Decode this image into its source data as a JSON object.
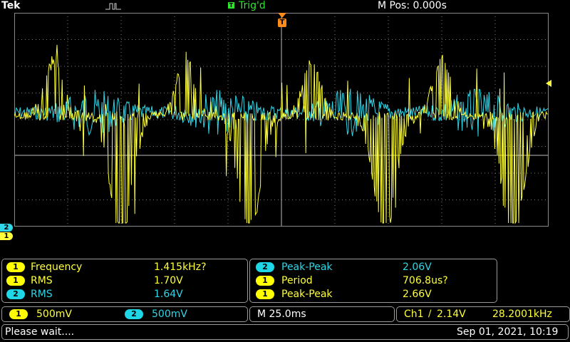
{
  "header": {
    "brand": "Tek",
    "trigger_icon": "T",
    "trigger_state": "Trig'd",
    "position": "M Pos: 0.000s"
  },
  "markers": {
    "trigger_marker": "T",
    "ch2_marker": "2",
    "ch1_marker": "1"
  },
  "measurements_left": [
    {
      "channel": "1",
      "label": "Frequency",
      "value": "1.415kHz?"
    },
    {
      "channel": "1",
      "label": "RMS",
      "value": "1.70V"
    },
    {
      "channel": "2",
      "label": "RMS",
      "value": "1.64V"
    }
  ],
  "measurements_right": [
    {
      "channel": "2",
      "label": "Peak-Peak",
      "value": "2.06V"
    },
    {
      "channel": "1",
      "label": "Period",
      "value": "706.8us?"
    },
    {
      "channel": "1",
      "label": "Peak-Peak",
      "value": "2.66V"
    }
  ],
  "scale": {
    "ch1_badge": "1",
    "ch1_scale": "500mV",
    "ch2_badge": "2",
    "ch2_scale": "500mV",
    "timebase": "M 25.0ms",
    "trigger_source": "Ch1",
    "trigger_slope": "∕",
    "trigger_level": "2.14V",
    "trigger_freq": "28.2001kHz"
  },
  "status": {
    "message": "Please wait....",
    "datetime": "Sep 01, 2021, 10:19"
  },
  "colors": {
    "ch1": "#ffff3c",
    "ch2": "#2fd6e8",
    "grid": "#7a7a7a",
    "trigger": "#ff8c1a",
    "accent": "#2ee62e"
  }
}
